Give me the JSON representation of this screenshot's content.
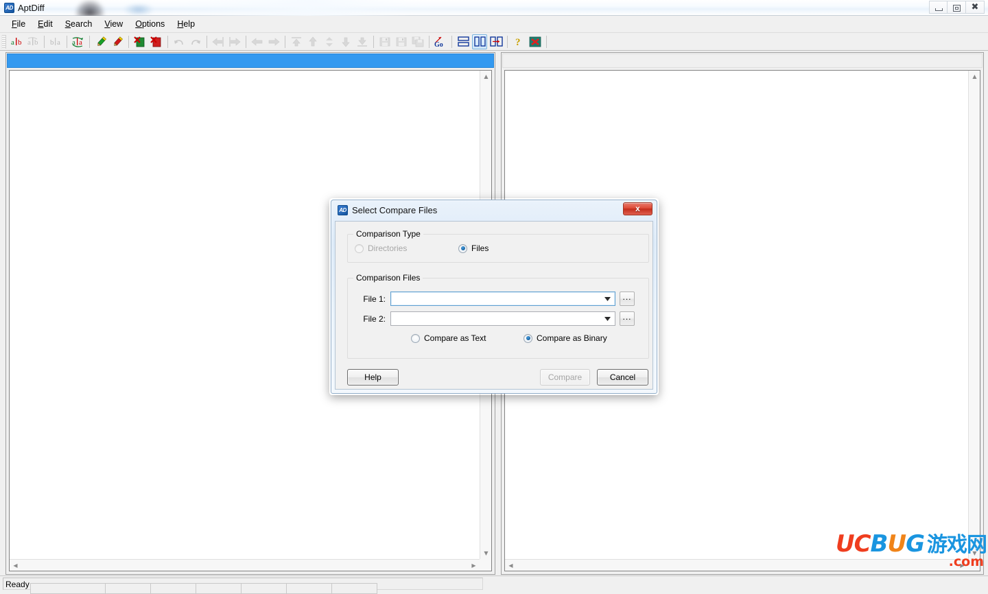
{
  "window": {
    "title": "AptDiff",
    "icon": "app-icon",
    "controls": [
      {
        "name": "minimize",
        "glyph": "minimize-icon"
      },
      {
        "name": "restore",
        "glyph": "restore-icon"
      },
      {
        "name": "close",
        "glyph": "close-icon"
      }
    ]
  },
  "menubar": {
    "items": [
      {
        "label": "File",
        "accel": "F"
      },
      {
        "label": "Edit",
        "accel": "E"
      },
      {
        "label": "Search",
        "accel": "S"
      },
      {
        "label": "View",
        "accel": "V"
      },
      {
        "label": "Options",
        "accel": "O"
      },
      {
        "label": "Help",
        "accel": "H"
      }
    ]
  },
  "toolbar": {
    "buttons": [
      {
        "name": "compare-files-icon",
        "title": "Compare Files",
        "enabled": true
      },
      {
        "name": "compare-directories-icon",
        "title": "Compare Directories",
        "enabled": false
      },
      {
        "name": "swap-files-icon",
        "title": "Swap Files",
        "enabled": false
      },
      {
        "name": "recompare-icon",
        "title": "Recompare",
        "enabled": true
      },
      {
        "name": "edit-left-icon",
        "title": "Edit Left File",
        "enabled": true
      },
      {
        "name": "edit-right-icon",
        "title": "Edit Right File",
        "enabled": true
      },
      {
        "name": "close-left-icon",
        "title": "Close Left File",
        "enabled": true
      },
      {
        "name": "close-right-icon",
        "title": "Close Right File",
        "enabled": true
      },
      {
        "name": "undo-icon",
        "title": "Undo",
        "enabled": false
      },
      {
        "name": "redo-icon",
        "title": "Redo",
        "enabled": false
      },
      {
        "name": "copy-to-left-icon",
        "title": "Copy to Left",
        "enabled": false
      },
      {
        "name": "copy-to-right-icon",
        "title": "Copy to Right",
        "enabled": false
      },
      {
        "name": "previous-difference-icon",
        "title": "Previous Difference",
        "enabled": false
      },
      {
        "name": "next-difference-icon",
        "title": "Next Difference",
        "enabled": false
      },
      {
        "name": "first-difference-icon",
        "title": "First Difference",
        "enabled": false
      },
      {
        "name": "previous-change-icon",
        "title": "Previous Change",
        "enabled": false
      },
      {
        "name": "current-difference-icon",
        "title": "Current Difference",
        "enabled": false
      },
      {
        "name": "next-change-icon",
        "title": "Next Change",
        "enabled": false
      },
      {
        "name": "last-difference-icon",
        "title": "Last Difference",
        "enabled": false
      },
      {
        "name": "save-left-icon",
        "title": "Save Left",
        "enabled": false
      },
      {
        "name": "save-right-icon",
        "title": "Save Right",
        "enabled": false
      },
      {
        "name": "save-all-icon",
        "title": "Save All",
        "enabled": false
      },
      {
        "name": "goto-line-icon",
        "title": "Go To",
        "enabled": true
      },
      {
        "name": "horizontal-split-icon",
        "title": "Horizontal Split",
        "enabled": true
      },
      {
        "name": "vertical-split-icon",
        "title": "Vertical Split",
        "enabled": true,
        "active": true
      },
      {
        "name": "synchronize-panes-icon",
        "title": "Synchronize Panes",
        "enabled": true
      },
      {
        "name": "help-icon",
        "title": "Help",
        "enabled": true
      },
      {
        "name": "exit-icon",
        "title": "Exit",
        "enabled": true
      }
    ]
  },
  "panes": {
    "left": {
      "name": "left-document-pane",
      "active": true
    },
    "right": {
      "name": "right-document-pane",
      "active": false
    }
  },
  "statusbar": {
    "message": "Ready",
    "panels": [
      "",
      "",
      "",
      "",
      "",
      "",
      ""
    ]
  },
  "watermark": {
    "uc": "UC",
    "b": "B",
    "u": "U",
    "g": "G",
    "cn": "游戏网",
    "dotcom": ".com"
  },
  "dialog": {
    "title": "Select Compare Files",
    "close_label": "x",
    "comparison_type": {
      "group_label": "Comparison Type",
      "options": [
        {
          "label": "Directories",
          "selected": false,
          "enabled": false
        },
        {
          "label": "Files",
          "selected": true,
          "enabled": true
        }
      ]
    },
    "comparison_files": {
      "group_label": "Comparison Files",
      "file1_label": "File 1:",
      "file1_value": "",
      "file2_label": "File 2:",
      "file2_value": "",
      "browse_label": "...",
      "mode_options": [
        {
          "label": "Compare as Text",
          "selected": false
        },
        {
          "label": "Compare as Binary",
          "selected": true
        }
      ]
    },
    "buttons": {
      "help": "Help",
      "compare": "Compare",
      "compare_enabled": false,
      "cancel": "Cancel"
    }
  },
  "colors": {
    "active_caption": "#3399f0",
    "dialog_close_red": "#c32d1c",
    "radio_blue": "#17619f",
    "watermark_red": "#ef3d1e",
    "watermark_blue": "#1a95e0",
    "watermark_orange": "#f08419"
  }
}
